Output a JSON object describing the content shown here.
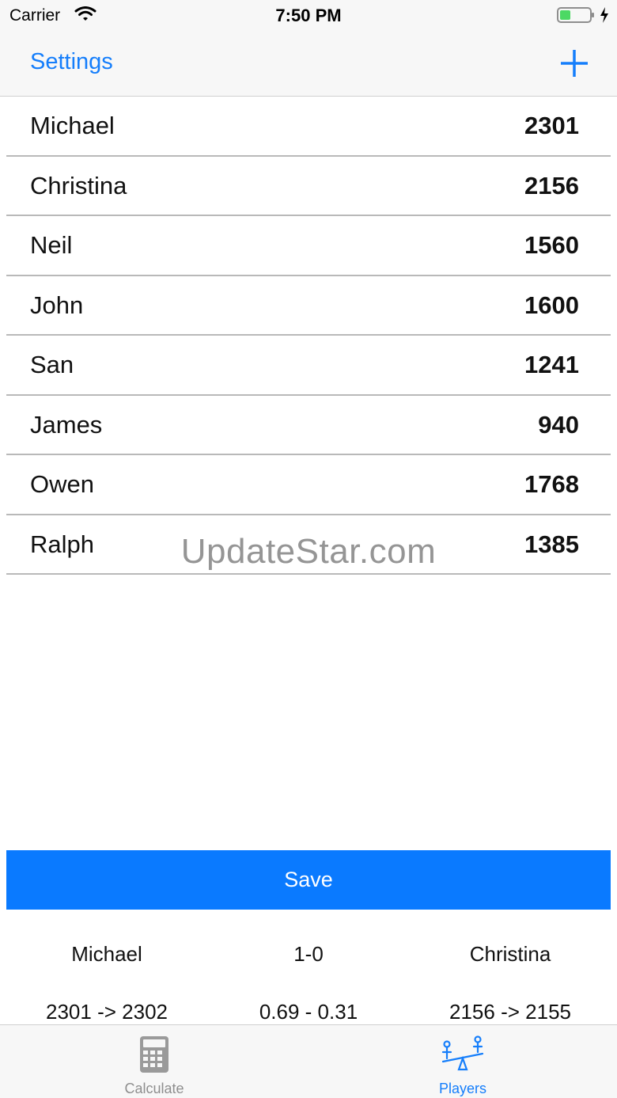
{
  "status_bar": {
    "carrier": "Carrier",
    "time": "7:50 PM",
    "battery_color": "#4cd964"
  },
  "nav": {
    "left_label": "Settings",
    "add_icon": "plus-icon",
    "accent_color": "#157efb"
  },
  "players": [
    {
      "name": "Michael",
      "rating": "2301"
    },
    {
      "name": "Christina",
      "rating": "2156"
    },
    {
      "name": "Neil",
      "rating": "1560"
    },
    {
      "name": "John",
      "rating": "1600"
    },
    {
      "name": "San",
      "rating": "1241"
    },
    {
      "name": "James",
      "rating": "940"
    },
    {
      "name": "Owen",
      "rating": "1768"
    },
    {
      "name": "Ralph",
      "rating": "1385"
    }
  ],
  "watermark": "UpdateStar.com",
  "save": {
    "label": "Save",
    "color": "#0a7aff"
  },
  "result": {
    "player_a": "Michael",
    "score": "1-0",
    "player_b": "Christina",
    "change_a": "2301 -> 2302",
    "expectation": "0.69 - 0.31",
    "change_b": "2156 -> 2155"
  },
  "tabs": [
    {
      "label": "Calculate",
      "icon": "calculator-icon",
      "active": false
    },
    {
      "label": "Players",
      "icon": "seesaw-icon",
      "active": true
    }
  ]
}
